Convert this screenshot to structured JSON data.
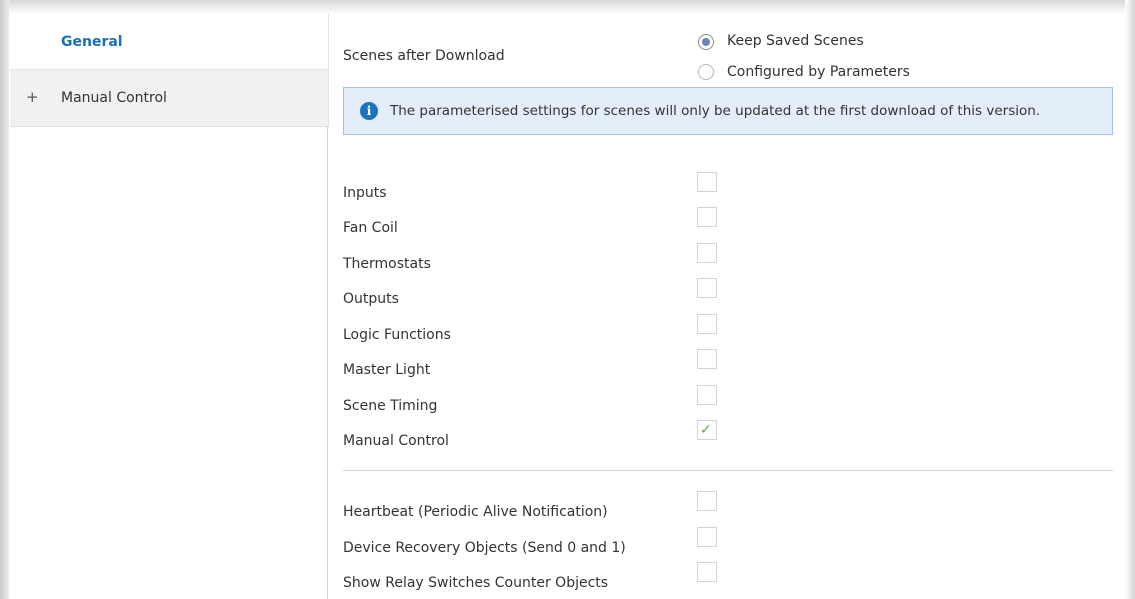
{
  "sidebar": {
    "items": [
      {
        "label": "General"
      },
      {
        "label": "Manual Control",
        "expander": "+"
      }
    ]
  },
  "main": {
    "scenes": {
      "label": "Scenes after Download",
      "options": [
        {
          "label": "Keep Saved Scenes",
          "selected": true
        },
        {
          "label": "Configured by Parameters",
          "selected": false
        }
      ]
    },
    "info": {
      "icon": "i",
      "text": "The parameterised settings for scenes will only be updated at the first download of this version."
    },
    "modules": [
      {
        "label": "Inputs",
        "checked": false
      },
      {
        "label": "Fan Coil",
        "checked": false
      },
      {
        "label": "Thermostats",
        "checked": false
      },
      {
        "label": "Outputs",
        "checked": false
      },
      {
        "label": "Logic Functions",
        "checked": false
      },
      {
        "label": "Master Light",
        "checked": false
      },
      {
        "label": "Scene Timing",
        "checked": false
      },
      {
        "label": "Manual Control",
        "checked": true
      }
    ],
    "extras": [
      {
        "label": "Heartbeat (Periodic Alive Notification)",
        "checked": false
      },
      {
        "label": "Device Recovery Objects (Send 0 and 1)",
        "checked": false
      },
      {
        "label": "Show Relay Switches Counter Objects",
        "checked": false
      }
    ],
    "check_glyph": "✓"
  },
  "colors": {
    "accent": "#1a6fb5",
    "info_bg": "#e4eef8",
    "info_border": "#a9c3de",
    "check": "#5aa73e",
    "radio_dot": "#6d85b6"
  }
}
